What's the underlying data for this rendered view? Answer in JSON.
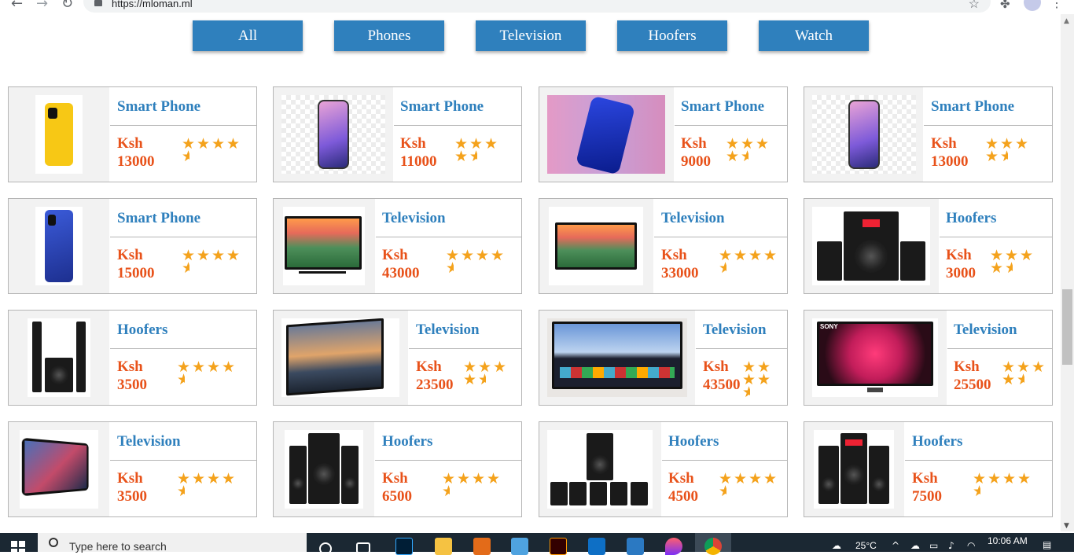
{
  "browser": {
    "url": "https://mloman.ml",
    "back_icon": "←",
    "forward_icon": "→",
    "reload_icon": "↻",
    "bookmark_icon": "☆",
    "extensions_icon": "✤",
    "menu_icon": "⋮"
  },
  "filters": [
    {
      "label": "All"
    },
    {
      "label": "Phones"
    },
    {
      "label": "Television"
    },
    {
      "label": "Hoofers"
    },
    {
      "label": "Watch"
    }
  ],
  "currency": "Ksh",
  "products": [
    {
      "title": "Smart Phone",
      "price": "13000",
      "rating": 4.5
    },
    {
      "title": "Smart Phone",
      "price": "11000",
      "rating": 4.5
    },
    {
      "title": "Smart Phone",
      "price": "9000",
      "rating": 4.5
    },
    {
      "title": "Smart Phone",
      "price": "13000",
      "rating": 4.5
    },
    {
      "title": "Smart Phone",
      "price": "15000",
      "rating": 4.5
    },
    {
      "title": "Television",
      "price": "43000",
      "rating": 4.5
    },
    {
      "title": "Television",
      "price": "33000",
      "rating": 4.5
    },
    {
      "title": "Hoofers",
      "price": "3000",
      "rating": 4.5
    },
    {
      "title": "Hoofers",
      "price": "3500",
      "rating": 4.5
    },
    {
      "title": "Television",
      "price": "23500",
      "rating": 4.5
    },
    {
      "title": "Television",
      "price": "43500",
      "rating": 4.5
    },
    {
      "title": "Television",
      "price": "25500",
      "rating": 4.5
    },
    {
      "title": "Television",
      "price": "3500",
      "rating": 4.5
    },
    {
      "title": "Hoofers",
      "price": "6500",
      "rating": 4.5
    },
    {
      "title": "Hoofers",
      "price": "4500",
      "rating": 4.5
    },
    {
      "title": "Hoofers",
      "price": "7500",
      "rating": 4.5
    }
  ],
  "colors": {
    "accent_blue": "#2f80bd",
    "price_orange": "#e8521a",
    "star_gold": "#f4a21c"
  },
  "taskbar": {
    "search_placeholder": "Type here to search",
    "weather": "25°C",
    "clock": "10:06 AM"
  }
}
